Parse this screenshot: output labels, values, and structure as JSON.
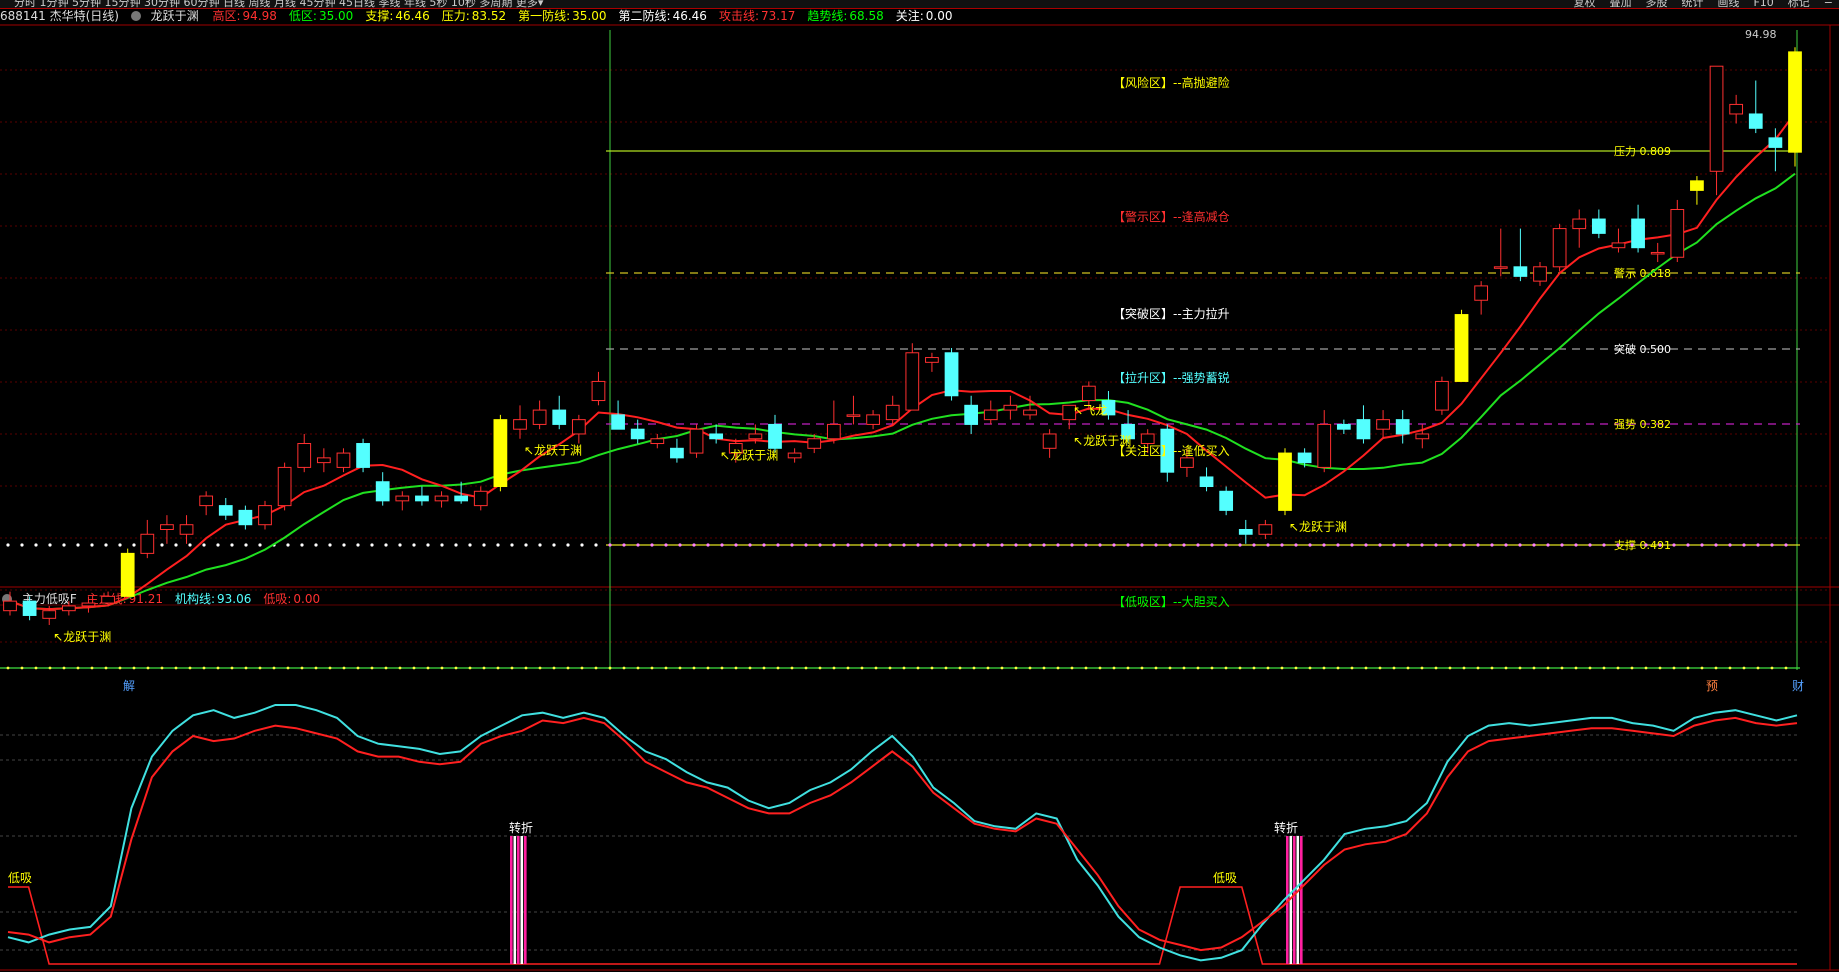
{
  "colors": {
    "up": "#ff3030",
    "down": "#54ffff",
    "highlight": "#ffff00",
    "ma_fast": "#ff2020",
    "ma_slow": "#20e020",
    "label_yellow": "#ffff00",
    "label_red": "#ff3030",
    "label_green": "#00ff00"
  },
  "toolbar": {
    "periods": "分时 1分钟 5分钟 15分钟 30分钟 60分钟 日线 周线 月线 45分钟 45日线 季线 年线 5秒 10秒 多周期 更多▾",
    "tools": [
      "复权",
      "叠加",
      "多股",
      "统计",
      "画线",
      "F10",
      "标记",
      "−"
    ]
  },
  "main_header": {
    "stock": "688141 杰华特(日线)",
    "indicator": "龙跃于渊",
    "items": [
      {
        "label": "高区:",
        "value": "94.98",
        "color": "#ff3030"
      },
      {
        "label": "低区:",
        "value": "35.00",
        "color": "#00ff00"
      },
      {
        "label": "支撑:",
        "value": "46.46",
        "color": "#ffff00"
      },
      {
        "label": "压力:",
        "value": "83.52",
        "color": "#ffff00"
      },
      {
        "label": "第一防线:",
        "value": "35.00",
        "color": "#ffff00"
      },
      {
        "label": "第二防线:",
        "value": "46.46",
        "color": "#ffffff"
      },
      {
        "label": "攻击线:",
        "value": "73.17",
        "color": "#ff3030"
      },
      {
        "label": "趋势线:",
        "value": "68.58",
        "color": "#00ff00"
      },
      {
        "label": "关注:",
        "value": "0.00",
        "color": "#ffffff"
      }
    ]
  },
  "zones": [
    {
      "text": "【风险区】--高抛避险",
      "color": "#ffff00"
    },
    {
      "text": "【警示区】--逢高减仓",
      "color": "#ff3030"
    },
    {
      "text": "【突破区】--主力拉升",
      "color": "#ffffff"
    },
    {
      "text": "【拉升区】--强势蓄锐",
      "color": "#54ffff"
    },
    {
      "text": "【关注区】--逢低买入",
      "color": "#ffff00"
    },
    {
      "text": "【低吸区】--大胆买入",
      "color": "#00ff00"
    }
  ],
  "levels": [
    {
      "text": "压力 0.809",
      "color": "#ffff00"
    },
    {
      "text": "警示 0.618",
      "color": "#ffff00"
    },
    {
      "text": "突破 0.500",
      "color": "#ffffff"
    },
    {
      "text": "强势 0.382",
      "color": "#ffff00"
    },
    {
      "text": "支撑 0.491",
      "color": "#ffff00"
    }
  ],
  "price_high_label": "94.98",
  "signal_label": "龙跃于渊",
  "flying_dragon_label": "飞龙",
  "axis_markers": {
    "left": "解",
    "right1": "预",
    "right2": "财"
  },
  "candles": [
    [
      36.0,
      38.0,
      35.5,
      37.0
    ],
    [
      37.0,
      37.5,
      35.0,
      35.5
    ],
    [
      35.2,
      36.5,
      34.5,
      36.0
    ],
    [
      36.0,
      37.0,
      35.5,
      36.5
    ],
    [
      36.5,
      37.5,
      35.8,
      36.8
    ],
    [
      36.8,
      38.0,
      36.5,
      37.5
    ],
    [
      37.5,
      42.5,
      37.5,
      42.0
    ],
    [
      42.0,
      45.5,
      41.5,
      44.0
    ],
    [
      44.5,
      46.0,
      43.0,
      45.0
    ],
    [
      44.0,
      46.0,
      43.0,
      45.0
    ],
    [
      47.0,
      48.5,
      46.0,
      48.0
    ],
    [
      47.0,
      47.8,
      45.5,
      46.0
    ],
    [
      46.5,
      47.0,
      44.5,
      45.0
    ],
    [
      45.0,
      47.5,
      44.5,
      47.0
    ],
    [
      47.0,
      51.5,
      46.5,
      51.0
    ],
    [
      51.0,
      54.5,
      50.5,
      53.5
    ],
    [
      51.5,
      53.0,
      50.5,
      52.0
    ],
    [
      51.0,
      53.0,
      50.5,
      52.5
    ],
    [
      53.5,
      54.0,
      50.5,
      51.0
    ],
    [
      49.5,
      50.5,
      47.0,
      47.5
    ],
    [
      47.5,
      48.5,
      46.5,
      48.0
    ],
    [
      48.0,
      49.0,
      47.0,
      47.5
    ],
    [
      47.5,
      48.5,
      46.8,
      48.0
    ],
    [
      48.0,
      49.5,
      47.2,
      47.5
    ],
    [
      47.0,
      49.0,
      46.5,
      48.5
    ],
    [
      49.0,
      56.5,
      48.5,
      56.0
    ],
    [
      55.0,
      57.5,
      54.0,
      56.0
    ],
    [
      55.5,
      58.0,
      55.0,
      57.0
    ],
    [
      57.0,
      58.5,
      55.0,
      55.5
    ],
    [
      54.5,
      56.5,
      53.5,
      56.0
    ],
    [
      58.0,
      61.0,
      57.5,
      60.0
    ],
    [
      56.5,
      58.0,
      55.0,
      55.0
    ],
    [
      55.0,
      56.0,
      53.5,
      54.0
    ],
    [
      53.5,
      54.5,
      53.0,
      54.0
    ],
    [
      53.0,
      54.0,
      51.5,
      52.0
    ],
    [
      52.5,
      55.5,
      52.0,
      55.0
    ],
    [
      54.5,
      55.5,
      53.5,
      54.0
    ],
    [
      52.5,
      54.0,
      51.5,
      53.5
    ],
    [
      54.0,
      55.5,
      53.5,
      54.5
    ],
    [
      55.5,
      56.5,
      52.5,
      53.0
    ],
    [
      52.0,
      53.0,
      51.5,
      52.5
    ],
    [
      53.0,
      54.5,
      52.5,
      54.0
    ],
    [
      54.0,
      58.0,
      53.5,
      55.5
    ],
    [
      56.5,
      58.5,
      55.5,
      56.5
    ],
    [
      55.5,
      57.0,
      55.0,
      56.5
    ],
    [
      56.0,
      58.5,
      55.5,
      57.5
    ],
    [
      57.0,
      64.0,
      57.0,
      63.0
    ],
    [
      62.0,
      63.0,
      61.0,
      62.5
    ],
    [
      63.0,
      63.5,
      58.0,
      58.5
    ],
    [
      57.5,
      58.5,
      54.5,
      55.5
    ],
    [
      56.0,
      58.0,
      55.5,
      57.0
    ],
    [
      57.0,
      58.5,
      56.0,
      57.5
    ],
    [
      56.5,
      58.5,
      56.0,
      57.0
    ],
    [
      53.0,
      55.0,
      52.0,
      54.5
    ],
    [
      56.0,
      57.5,
      55.0,
      57.5
    ],
    [
      58.0,
      60.0,
      57.0,
      59.5
    ],
    [
      58.0,
      59.0,
      56.0,
      56.5
    ],
    [
      55.5,
      57.0,
      53.5,
      54.0
    ],
    [
      53.5,
      55.0,
      52.5,
      54.5
    ],
    [
      55.0,
      55.5,
      49.5,
      50.5
    ],
    [
      51.0,
      53.0,
      50.0,
      52.0
    ],
    [
      50.0,
      51.0,
      48.5,
      49.0
    ],
    [
      48.5,
      49.0,
      46.0,
      46.5
    ],
    [
      44.5,
      45.5,
      43.0,
      44.0
    ],
    [
      44.0,
      45.5,
      43.5,
      45.0
    ],
    [
      46.5,
      53.0,
      46.0,
      52.5
    ],
    [
      52.5,
      53.0,
      51.0,
      51.5
    ],
    [
      51.0,
      57.0,
      50.5,
      55.5
    ],
    [
      55.5,
      56.0,
      54.5,
      55.0
    ],
    [
      56.0,
      57.5,
      53.5,
      54.0
    ],
    [
      55.0,
      57.0,
      54.0,
      56.0
    ],
    [
      56.0,
      57.0,
      53.5,
      54.5
    ],
    [
      54.0,
      55.5,
      53.0,
      54.5
    ],
    [
      57.0,
      60.5,
      56.5,
      60.0
    ],
    [
      60.0,
      67.5,
      60.0,
      67.0
    ],
    [
      68.5,
      70.5,
      67.0,
      70.0
    ],
    [
      72.0,
      76.0,
      71.0,
      72.0
    ],
    [
      72.0,
      76.0,
      70.5,
      71.0
    ],
    [
      70.5,
      72.5,
      70.0,
      72.0
    ],
    [
      72.0,
      76.5,
      71.5,
      76.0
    ],
    [
      76.0,
      78.0,
      74.0,
      77.0
    ],
    [
      77.0,
      78.0,
      75.0,
      75.5
    ],
    [
      74.0,
      76.0,
      73.5,
      74.5
    ],
    [
      77.0,
      78.5,
      73.5,
      74.0
    ],
    [
      73.5,
      74.5,
      72.5,
      73.5
    ],
    [
      73.0,
      79.0,
      72.5,
      78.0
    ],
    [
      80.0,
      81.5,
      78.5,
      81.0
    ],
    [
      82.0,
      86.0,
      79.5,
      93.0
    ],
    [
      88.0,
      90.0,
      87.0,
      89.0
    ],
    [
      88.0,
      91.5,
      86.0,
      86.5
    ],
    [
      85.5,
      86.5,
      82.0,
      84.5
    ],
    [
      84.0,
      94.98,
      82.5,
      94.5
    ]
  ],
  "highlight_candles": [
    6,
    25,
    65,
    74,
    86,
    91
  ],
  "signals": [
    2,
    26,
    36,
    54,
    65
  ],
  "sub_header": {
    "name": "主力低吸F",
    "items": [
      {
        "label": "主力线:",
        "value": "91.21",
        "color": "#ff3030"
      },
      {
        "label": "机构线:",
        "value": "93.06",
        "color": "#54ffff"
      },
      {
        "label": "低吸:",
        "value": "0.00",
        "color": "#ff3030"
      }
    ]
  },
  "sub_labels": {
    "low_buy": "低吸",
    "turn": "转折"
  },
  "cyan_series": [
    10,
    8,
    11,
    13,
    14,
    22,
    60,
    80,
    90,
    96,
    98,
    95,
    97,
    100,
    100,
    98,
    95,
    88,
    85,
    84,
    83,
    81,
    82,
    88,
    92,
    96,
    97,
    95,
    97,
    95,
    88,
    82,
    79,
    74,
    70,
    68,
    63,
    60,
    62,
    67,
    70,
    75,
    82,
    88,
    80,
    68,
    62,
    55,
    53,
    52,
    58,
    56,
    40,
    30,
    18,
    10,
    6,
    3,
    1,
    2,
    5,
    15,
    24,
    32,
    40,
    50,
    52,
    53,
    55,
    62,
    78,
    88,
    92,
    93,
    92,
    93,
    94,
    95,
    95,
    93,
    92,
    90,
    95,
    97,
    98,
    96,
    94,
    96
  ],
  "red_series": [
    12,
    11,
    8,
    10,
    11,
    18,
    48,
    72,
    82,
    88,
    86,
    87,
    90,
    92,
    91,
    89,
    87,
    82,
    80,
    80,
    78,
    77,
    78,
    85,
    88,
    90,
    94,
    93,
    95,
    93,
    86,
    78,
    74,
    70,
    68,
    64,
    60,
    58,
    58,
    62,
    65,
    70,
    76,
    82,
    76,
    66,
    60,
    54,
    52,
    51,
    56,
    54,
    44,
    34,
    22,
    13,
    9,
    7,
    5,
    6,
    10,
    16,
    22,
    30,
    38,
    44,
    46,
    47,
    50,
    58,
    72,
    82,
    86,
    87,
    88,
    89,
    90,
    91,
    91,
    90,
    89,
    88,
    92,
    94,
    95,
    93,
    92,
    93
  ],
  "lowbuy_series": [
    40,
    40,
    0,
    0,
    0,
    0,
    0,
    0,
    0,
    0,
    0,
    0,
    0,
    0,
    0,
    0,
    0,
    0,
    0,
    0,
    0,
    0,
    0,
    0,
    0,
    0,
    0,
    0,
    0,
    0,
    0,
    0,
    0,
    0,
    0,
    0,
    0,
    0,
    0,
    0,
    0,
    0,
    0,
    0,
    0,
    0,
    0,
    0,
    0,
    0,
    0,
    0,
    0,
    0,
    0,
    0,
    0,
    40,
    40,
    40,
    40,
    0,
    0,
    0,
    0,
    0,
    0,
    0,
    0,
    0,
    0,
    0,
    0,
    0,
    0,
    0,
    0,
    0,
    0,
    0,
    0,
    0,
    0,
    0,
    0,
    0,
    0,
    0
  ]
}
